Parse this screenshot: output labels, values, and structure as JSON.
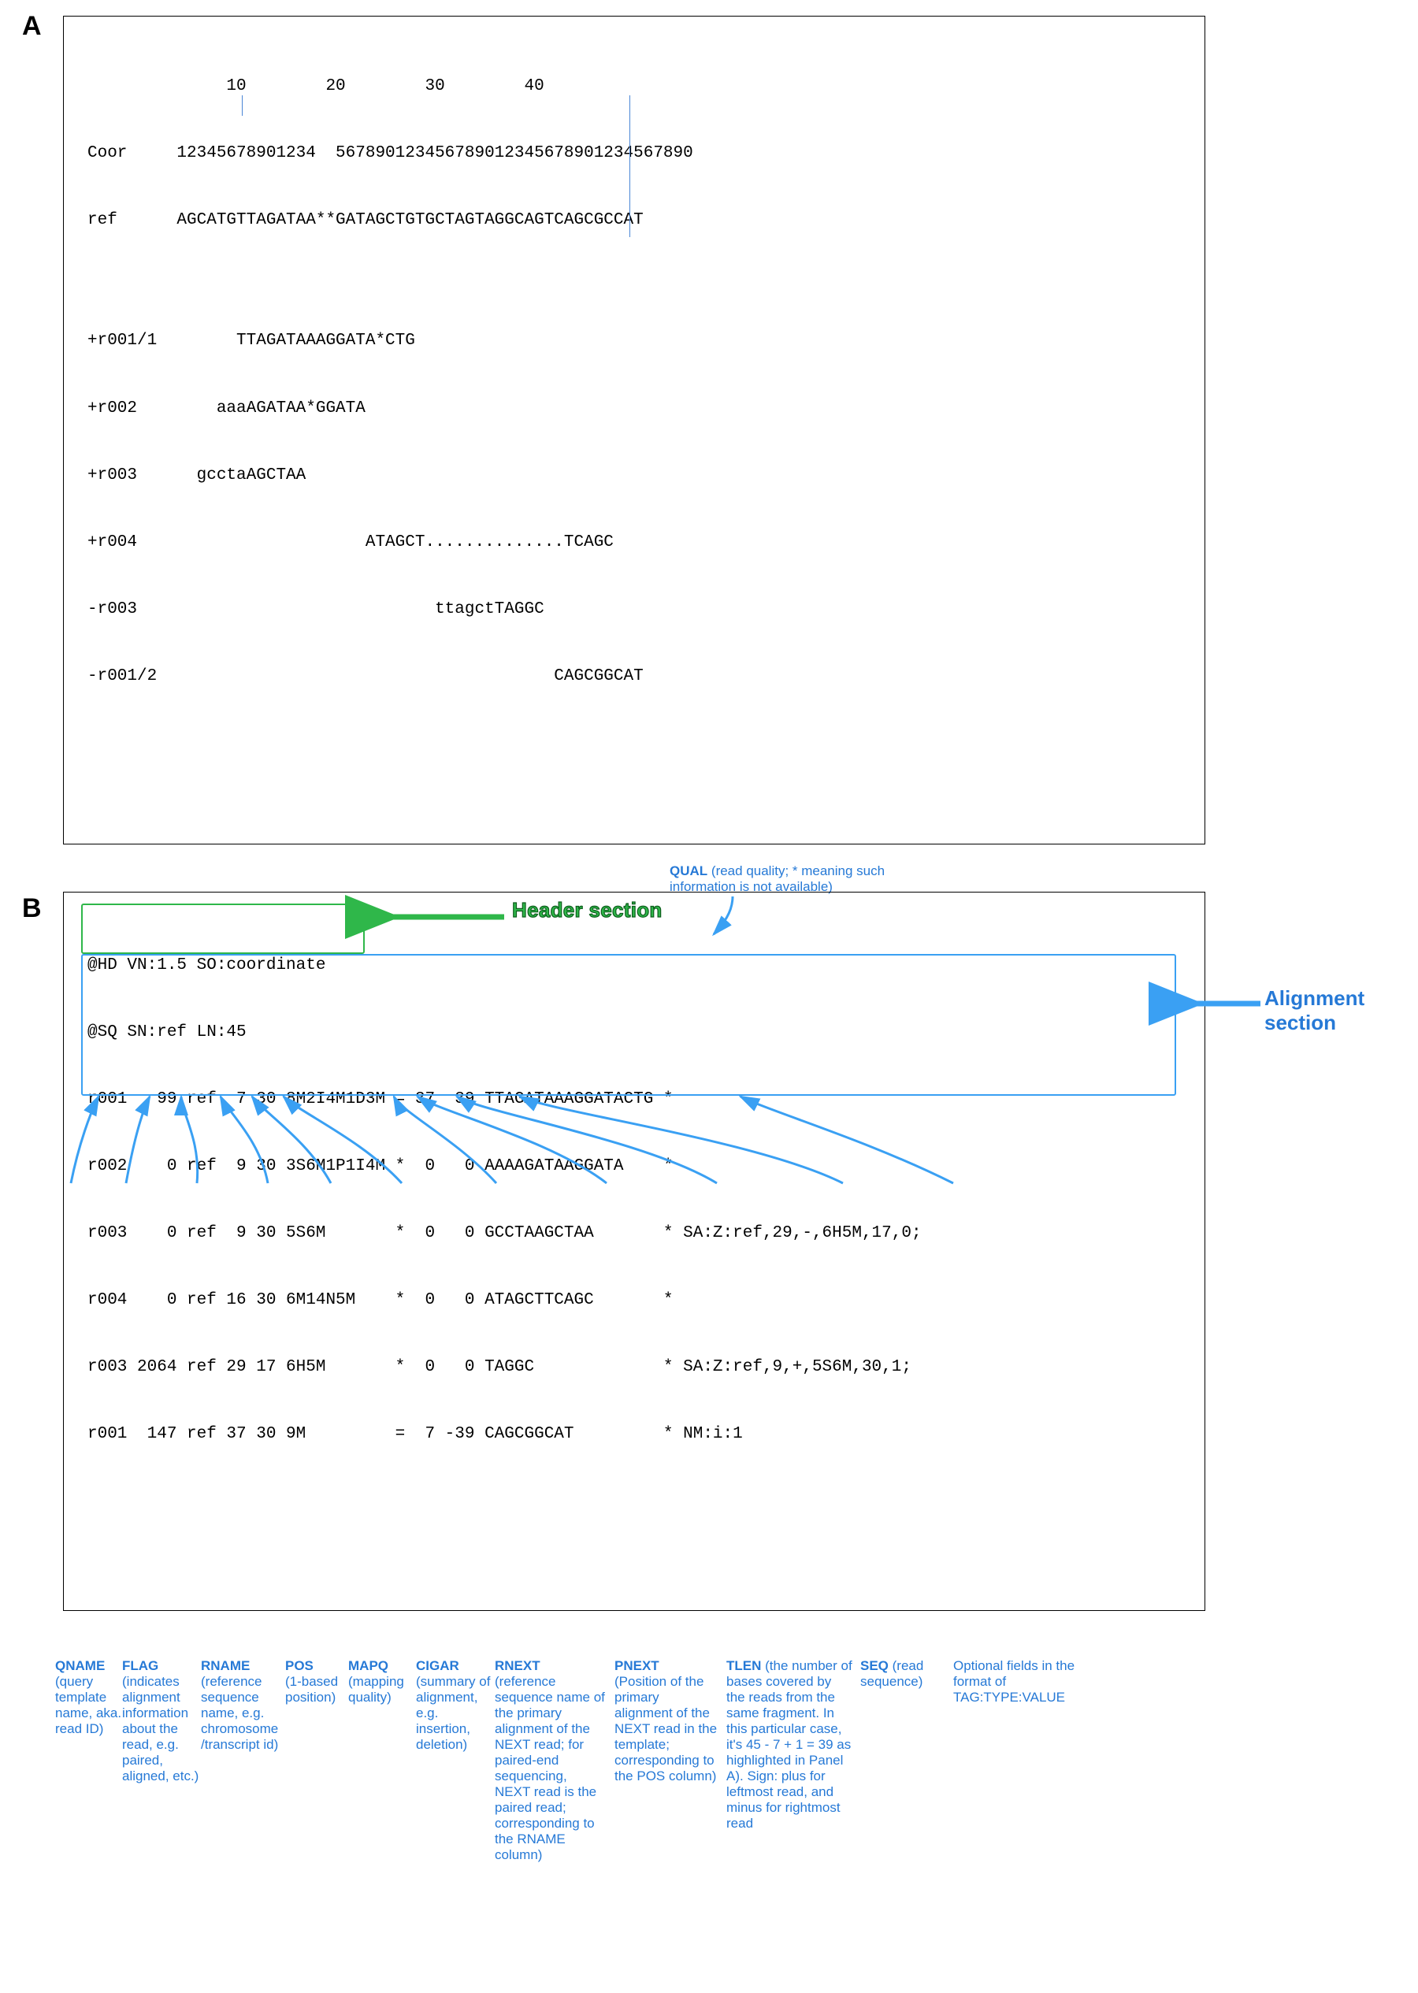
{
  "panelA": {
    "label": "A",
    "ruler": "              10        20        30        40",
    "coor": "Coor     12345678901234  567890123456789012345678901234567890",
    "ref": "ref      AGCATGTTAGATAA**GATAGCTGTGCTAGTAGGCAGTCAGCGCCAT",
    "reads": [
      "+r001/1        TTAGATAAAGGATA*CTG",
      "+r002        aaaAGATAA*GGATA",
      "+r003      gcctaAGCTAA",
      "+r004                       ATAGCT..............TCAGC",
      "-r003                              ttagctTAGGC",
      "-r001/2                                        CAGCGGCAT"
    ]
  },
  "panelB": {
    "label": "B",
    "header_lines": [
      "@HD VN:1.5 SO:coordinate",
      "@SQ SN:ref LN:45"
    ],
    "align_lines": [
      "r001   99 ref  7 30 8M2I4M1D3M = 37  39 TTAGATAAAGGATACTG *",
      "r002    0 ref  9 30 3S6M1P1I4M *  0   0 AAAAGATAAGGATA    *",
      "r003    0 ref  9 30 5S6M       *  0   0 GCCTAAGCTAA       * SA:Z:ref,29,-,6H5M,17,0;",
      "r004    0 ref 16 30 6M14N5M    *  0   0 ATAGCTTCAGC       *",
      "r003 2064 ref 29 17 6H5M       *  0   0 TAGGC             * SA:Z:ref,9,+,5S6M,30,1;",
      "r001  147 ref 37 30 9M         =  7 -39 CAGCGGCAT         * NM:i:1"
    ],
    "labels": {
      "header_section": "Header section",
      "alignment_section": "Alignment section"
    },
    "annotations": {
      "qname": {
        "title": "QNAME",
        "desc": "(query template name, aka. read ID)"
      },
      "flag": {
        "title": "FLAG",
        "desc": "(indicates alignment information about the read, e.g. paired, aligned, etc.)"
      },
      "rname": {
        "title": "RNAME",
        "desc": "(reference sequence name, e.g. chromosome /transcript id)"
      },
      "pos": {
        "title": "POS",
        "desc": "(1-based position)"
      },
      "mapq": {
        "title": "MAPQ",
        "desc": "(mapping quality)"
      },
      "cigar": {
        "title": "CIGAR",
        "desc": "(summary of alignment, e.g. insertion, deletion)"
      },
      "rnext": {
        "title": "RNEXT",
        "desc": "(reference sequence name of the primary alignment of the NEXT read; for paired-end sequencing, NEXT read is the paired read; corresponding to the RNAME column)"
      },
      "pnext": {
        "title": "PNEXT",
        "desc": "(Position of the primary alignment of the NEXT read in the template; corresponding to the POS column)"
      },
      "tlen": {
        "title": "TLEN",
        "desc": "(the number of bases covered by the reads from the same fragment. In this particular case, it's 45 - 7 + 1 = 39 as highlighted in Panel A). Sign: plus for leftmost read, and minus for rightmost read"
      },
      "seq": {
        "title": "SEQ",
        "desc": "(read sequence)"
      },
      "opt": {
        "title": "",
        "desc": "Optional fields in the format of TAG:TYPE:VALUE"
      },
      "qual": {
        "title": "QUAL",
        "desc": "(read quality; * meaning such information is not available)"
      }
    }
  }
}
